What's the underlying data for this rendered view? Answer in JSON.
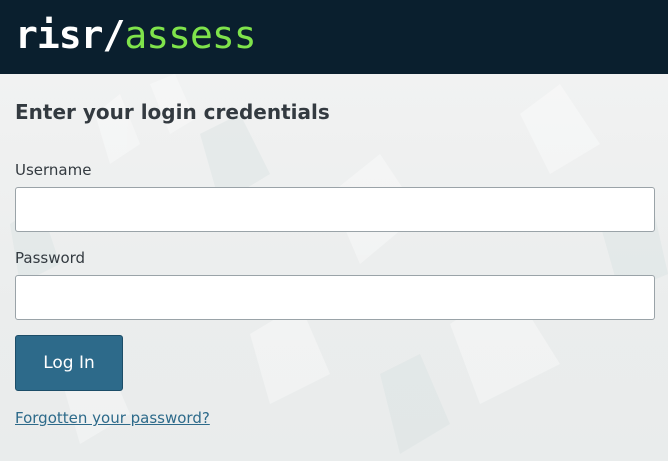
{
  "header": {
    "logo_prefix": "risr/",
    "logo_suffix": "assess"
  },
  "login": {
    "title": "Enter your login credentials",
    "username_label": "Username",
    "username_value": "",
    "password_label": "Password",
    "password_value": "",
    "login_button_label": "Log In",
    "forgot_password_label": "Forgotten your password?"
  },
  "colors": {
    "header_background": "#0a1f2e",
    "logo_white": "#ffffff",
    "logo_green": "#7fe34b",
    "primary_button": "#2d6a8a",
    "link": "#2d6a8a",
    "page_background": "#eef0f0"
  }
}
